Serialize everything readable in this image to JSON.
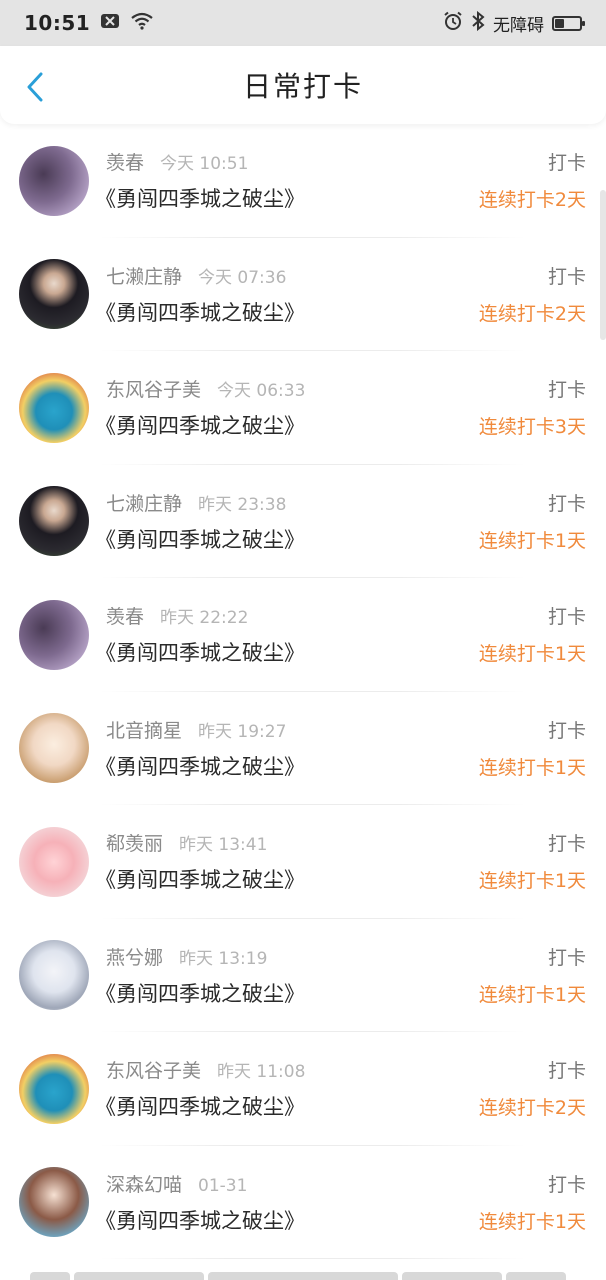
{
  "status_bar": {
    "time": "10:51",
    "accessibility": "无障碍",
    "icons": [
      "close-box-icon",
      "wifi-icon",
      "alarm-icon",
      "bluetooth-icon",
      "battery-icon"
    ]
  },
  "header": {
    "title": "日常打卡",
    "back_icon": "chevron-left-icon",
    "accent_color": "#2a9fd8"
  },
  "colors": {
    "streak": "#f08a3c",
    "name": "#8a8a8a",
    "time": "#b5b5b5"
  },
  "entries": [
    {
      "name": "羡春",
      "time": "今天 10:51",
      "action": "打卡",
      "book": "《勇闯四季城之破尘》",
      "streak": "连续打卡2天",
      "avatar": "purple"
    },
    {
      "name": "七濑庄静",
      "time": "今天 07:36",
      "action": "打卡",
      "book": "《勇闯四季城之破尘》",
      "streak": "连续打卡2天",
      "avatar": "dark"
    },
    {
      "name": "东风谷子美",
      "time": "今天 06:33",
      "action": "打卡",
      "book": "《勇闯四季城之破尘》",
      "streak": "连续打卡3天",
      "avatar": "car"
    },
    {
      "name": "七濑庄静",
      "time": "昨天 23:38",
      "action": "打卡",
      "book": "《勇闯四季城之破尘》",
      "streak": "连续打卡1天",
      "avatar": "dark"
    },
    {
      "name": "羡春",
      "time": "昨天 22:22",
      "action": "打卡",
      "book": "《勇闯四季城之破尘》",
      "streak": "连续打卡1天",
      "avatar": "purple"
    },
    {
      "name": "北音摘星",
      "time": "昨天 19:27",
      "action": "打卡",
      "book": "《勇闯四季城之破尘》",
      "streak": "连续打卡1天",
      "avatar": "girl"
    },
    {
      "name": "郗羡丽",
      "time": "昨天 13:41",
      "action": "打卡",
      "book": "《勇闯四季城之破尘》",
      "streak": "连续打卡1天",
      "avatar": "pink"
    },
    {
      "name": "燕兮娜",
      "time": "昨天 13:19",
      "action": "打卡",
      "book": "《勇闯四季城之破尘》",
      "streak": "连续打卡1天",
      "avatar": "white"
    },
    {
      "name": "东风谷子美",
      "time": "昨天 11:08",
      "action": "打卡",
      "book": "《勇闯四季城之破尘》",
      "streak": "连续打卡2天",
      "avatar": "car"
    },
    {
      "name": "深森幻喵",
      "time": "01-31",
      "action": "打卡",
      "book": "《勇闯四季城之破尘》",
      "streak": "连续打卡1天",
      "avatar": "brown"
    }
  ]
}
